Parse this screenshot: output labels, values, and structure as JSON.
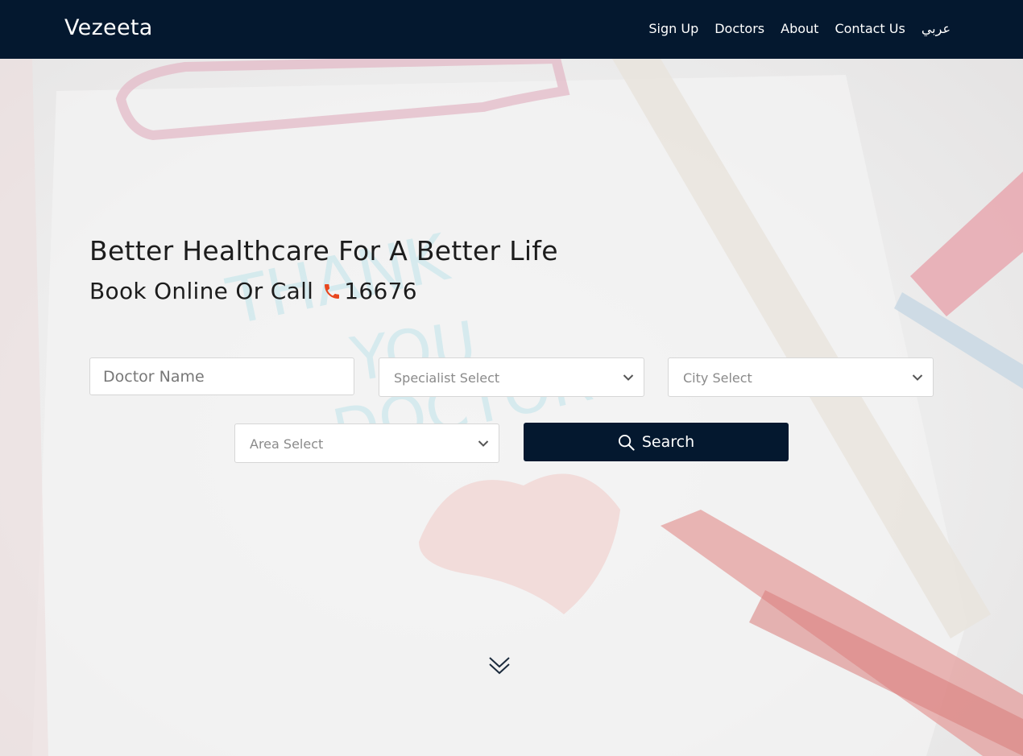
{
  "navbar": {
    "brand": "Vezeeta",
    "links": [
      "Sign Up",
      "Doctors",
      "About",
      "Contact Us",
      "عربي"
    ]
  },
  "hero": {
    "headline": "Better Healthcare For A Better Life",
    "subline_prefix": "Book Online Or Call",
    "phone_number": "16676",
    "background_text": [
      "THANK",
      "YOU",
      "DOCTOR"
    ]
  },
  "search_form": {
    "doctor_name_placeholder": "Doctor Name",
    "specialist_select": "Specialist Select",
    "city_select": "City Select",
    "area_select": "Area Select",
    "search_button": "Search"
  },
  "icons": {
    "phone": "phone-icon",
    "search": "search-icon",
    "chevron": "chevron-down-icon",
    "scroll": "double-chevron-down-icon"
  },
  "colors": {
    "navbar_bg": "#04182f",
    "button_bg": "#04182f",
    "phone_icon": "#e8461e"
  }
}
